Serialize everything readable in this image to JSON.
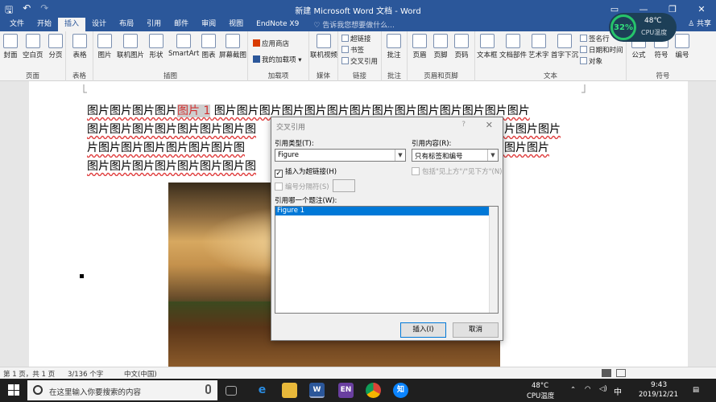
{
  "titlebar": {
    "title": "新建 Microsoft Word 文档 - Word",
    "save": "🖫",
    "undo": "↶",
    "redo": "↷"
  },
  "tabs": [
    {
      "label": "文件"
    },
    {
      "label": "开始"
    },
    {
      "label": "插入"
    },
    {
      "label": "设计"
    },
    {
      "label": "布局"
    },
    {
      "label": "引用"
    },
    {
      "label": "邮件"
    },
    {
      "label": "审阅"
    },
    {
      "label": "视图"
    },
    {
      "label": "EndNote X9"
    }
  ],
  "tellme": "♡ 告诉我您想要做什么...",
  "share": "♙ 共享",
  "ribbon": {
    "pages": {
      "label": "页面",
      "cover": "封面",
      "blank": "空白页",
      "break": "分页"
    },
    "tables": {
      "label": "表格",
      "table": "表格"
    },
    "illustrations": {
      "label": "插图",
      "picture": "图片",
      "online": "联机图片",
      "shapes": "形状",
      "smartart": "SmartArt",
      "chart": "图表",
      "screenshot": "屏幕截图"
    },
    "addins": {
      "label": "加载项",
      "store": "应用商店",
      "myaddins": "我的加载项"
    },
    "media": {
      "label": "媒体",
      "video": "联机视频"
    },
    "links": {
      "label": "链接",
      "hyperlink": "超链接",
      "bookmark": "书签",
      "crossref": "交叉引用"
    },
    "comments": {
      "label": "批注",
      "comment": "批注"
    },
    "headerfooter": {
      "label": "页眉和页脚",
      "header": "页眉",
      "footer": "页脚",
      "pagenum": "页码"
    },
    "text": {
      "label": "文本",
      "textbox": "文本框",
      "parts": "文档部件",
      "wordart": "艺术字",
      "dropcap": "首字下沉",
      "sigline": "签名行",
      "datetime": "日期和时间",
      "object": "对象"
    },
    "symbols": {
      "label": "符号",
      "equation": "公式",
      "symbol": "符号",
      "number": "编号"
    }
  },
  "temp_widget": {
    "percent": "32%",
    "temp": "48℃",
    "label": "CPU温度"
  },
  "document": {
    "line1_a": "图片图片图片图片",
    "line1_hl": "图片 1",
    "line1_b": " 图片图片图片图片图片图片图片图片图片图片图片图片图片图片",
    "line2_a": "图片图片图片图片图片图片图片图",
    "line2_b": "图片图片图片",
    "line3_a": "片图片图片图片图片图片图片图",
    "line3_b": "图片图片图片",
    "line4": "图片图片图片图片图片图片图片图"
  },
  "dialog": {
    "title": "交叉引用",
    "help": "?",
    "close": "✕",
    "ref_type_label": "引用类型(T):",
    "ref_type_value": "Figure",
    "ref_content_label": "引用内容(R):",
    "ref_content_value": "只有标签和编号",
    "insert_hyperlink": "插入为超链接(H)",
    "above_below": "包括\"见上方\"/\"见下方\"(N)",
    "separator": "编号分隔符(S)",
    "which_caption": "引用哪一个题注(W):",
    "caption_item": "Figure 1",
    "insert_btn": "插入(I)",
    "cancel_btn": "取消"
  },
  "status": {
    "page": "第 1 页，共 1 页",
    "words": "3/136 个字",
    "lang": "中文(中国)"
  },
  "taskbar": {
    "search_placeholder": "在这里输入你要搜索的内容",
    "temp": "48°C",
    "temp_label": "CPU温度",
    "ime": "中",
    "time": "9:43",
    "date": "2019/12/21",
    "en": "EN",
    "word": "W",
    "zhi": "知"
  }
}
